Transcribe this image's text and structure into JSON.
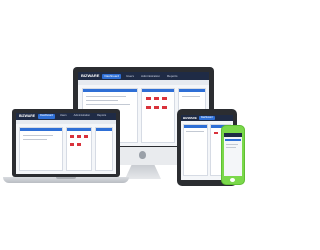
{
  "app": {
    "logo": "BIZWARE",
    "tabs": [
      {
        "label": "Dashboard",
        "active": true
      },
      {
        "label": "Users",
        "active": false
      },
      {
        "label": "Administration",
        "active": false
      },
      {
        "label": "Reports",
        "active": false
      }
    ]
  },
  "colors": {
    "nav_bar": "#1f2b45",
    "panel_header": "#2e6fd6",
    "status_red": "#d9323b",
    "phone_bezel": "#7bd84b",
    "device_frame": "#e4e6ea",
    "device_body": "#2b2d31"
  },
  "devices": [
    {
      "type": "desktop-monitor",
      "icon": "apple-logo-icon"
    },
    {
      "type": "laptop"
    },
    {
      "type": "tablet"
    },
    {
      "type": "phone"
    }
  ]
}
